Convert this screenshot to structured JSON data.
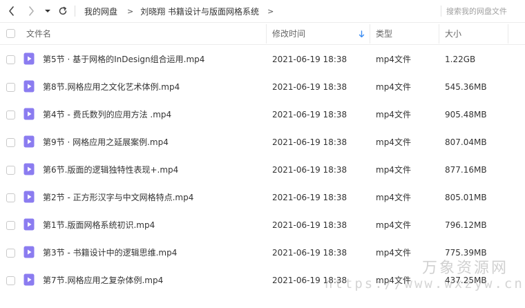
{
  "breadcrumb": {
    "items": [
      "我的网盘",
      "刘晓翔 书籍设计与版面网格系统"
    ],
    "separator": ">"
  },
  "search": {
    "placeholder": "搜索我的网盘文件"
  },
  "columns": {
    "name": "文件名",
    "modified": "修改时间",
    "type": "类型",
    "size": "大小"
  },
  "icons": {
    "back": "chevron-left-icon",
    "forward": "chevron-right-icon",
    "dropdown": "caret-down-icon",
    "refresh": "refresh-icon",
    "sort": "arrow-down-icon",
    "file": "video-file-icon"
  },
  "colors": {
    "accent": "#3b8cf2",
    "file_icon": "#8b7cf0",
    "text": "#333333",
    "muted": "#666666"
  },
  "files": [
    {
      "name": "第5节 · 基于网格的InDesign组合运用.mp4",
      "modified": "2021-06-19 18:38",
      "type": "mp4文件",
      "size": "1.22GB"
    },
    {
      "name": "第8节.网格应用之文化艺术体例.mp4",
      "modified": "2021-06-19 18:38",
      "type": "mp4文件",
      "size": "545.36MB"
    },
    {
      "name": "第4节 - 费氏数列的应用方法 .mp4",
      "modified": "2021-06-19 18:38",
      "type": "mp4文件",
      "size": "905.48MB"
    },
    {
      "name": "第9节 · 网格应用之延展案例.mp4",
      "modified": "2021-06-19 18:38",
      "type": "mp4文件",
      "size": "807.04MB"
    },
    {
      "name": "第6节.版面的逻辑独特性表现+.mp4",
      "modified": "2021-06-19 18:38",
      "type": "mp4文件",
      "size": "877.16MB"
    },
    {
      "name": "第2节 - 正方形汉字与中文网格特点.mp4",
      "modified": "2021-06-19 18:38",
      "type": "mp4文件",
      "size": "805.01MB"
    },
    {
      "name": "第1节.版面网格系统初识.mp4",
      "modified": "2021-06-19 18:38",
      "type": "mp4文件",
      "size": "796.12MB"
    },
    {
      "name": "第3节 - 书籍设计中的逻辑思维.mp4",
      "modified": "2021-06-19 18:38",
      "type": "mp4文件",
      "size": "775.39MB"
    },
    {
      "name": "第7节.网格应用之复杂体例.mp4",
      "modified": "2021-06-19 18:38",
      "type": "mp4文件",
      "size": "437.25MB"
    }
  ],
  "watermark": {
    "line1": "万象资源网",
    "line2": "https://www.wxzyw.cn"
  }
}
